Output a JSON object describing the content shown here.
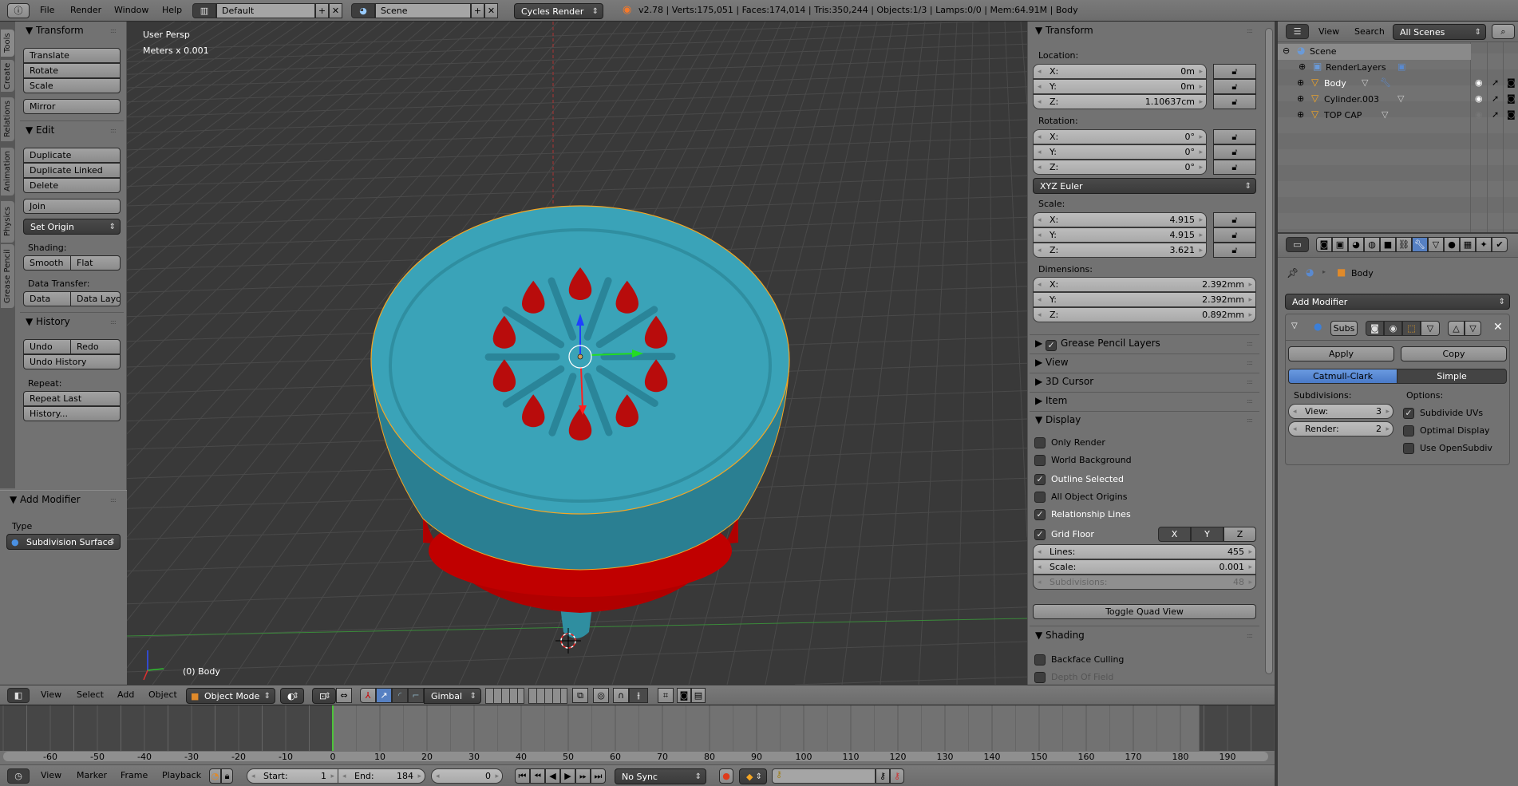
{
  "top_header": {
    "menus": [
      "File",
      "Render",
      "Window",
      "Help"
    ],
    "layout": "Default",
    "scene": "Scene",
    "engine": "Cycles Render",
    "stats": "v2.78 | Verts:175,051 | Faces:174,014 | Tris:350,244 | Objects:1/3 | Lamps:0/0 | Mem:64.91M | Body"
  },
  "tool_tabs": [
    "Tools",
    "Create",
    "Relations",
    "Animation",
    "Physics",
    "Grease Pencil"
  ],
  "toolshelf": {
    "transform": {
      "title": "Transform",
      "translate": "Translate",
      "rotate": "Rotate",
      "scale": "Scale",
      "mirror": "Mirror"
    },
    "edit": {
      "title": "Edit",
      "duplicate": "Duplicate",
      "duplicate_linked": "Duplicate Linked",
      "delete": "Delete",
      "join": "Join",
      "set_origin": "Set Origin",
      "shading_label": "Shading:",
      "smooth": "Smooth",
      "flat": "Flat",
      "data_transfer_label": "Data Transfer:",
      "data": "Data",
      "data_layout": "Data Layo"
    },
    "history": {
      "title": "History",
      "undo": "Undo",
      "redo": "Redo",
      "undo_history": "Undo History",
      "repeat_label": "Repeat:",
      "repeat_last": "Repeat Last",
      "history": "History..."
    },
    "operator": {
      "title": "Add Modifier",
      "type_label": "Type",
      "type_value": "Subdivision Surface"
    }
  },
  "viewport": {
    "view_name": "User Persp",
    "units": "Meters x 0.001",
    "object_label": "(0) Body",
    "colors": {
      "body": "#3aa3b8",
      "accent": "#c00000",
      "selection": "#f5a623"
    }
  },
  "n_panel": {
    "transform_title": "Transform",
    "location_label": "Location:",
    "location": [
      {
        "axis": "X:",
        "value": "0m"
      },
      {
        "axis": "Y:",
        "value": "0m"
      },
      {
        "axis": "Z:",
        "value": "1.10637cm"
      }
    ],
    "rotation_label": "Rotation:",
    "rotation": [
      {
        "axis": "X:",
        "value": "0°"
      },
      {
        "axis": "Y:",
        "value": "0°"
      },
      {
        "axis": "Z:",
        "value": "0°"
      }
    ],
    "rotation_mode": "XYZ Euler",
    "scale_label": "Scale:",
    "scale": [
      {
        "axis": "X:",
        "value": "4.915"
      },
      {
        "axis": "Y:",
        "value": "4.915"
      },
      {
        "axis": "Z:",
        "value": "3.621"
      }
    ],
    "dimensions_label": "Dimensions:",
    "dimensions": [
      {
        "axis": "X:",
        "value": "2.392mm"
      },
      {
        "axis": "Y:",
        "value": "2.392mm"
      },
      {
        "axis": "Z:",
        "value": "0.892mm"
      }
    ],
    "collapsed_panels": [
      "Grease Pencil Layers",
      "View",
      "3D Cursor",
      "Item"
    ],
    "display": {
      "title": "Display",
      "options": [
        {
          "label": "Only Render",
          "checked": false
        },
        {
          "label": "World Background",
          "checked": false
        },
        {
          "label": "Outline Selected",
          "checked": true
        },
        {
          "label": "All Object Origins",
          "checked": false
        },
        {
          "label": "Relationship Lines",
          "checked": true
        },
        {
          "label": "Grid Floor",
          "checked": true
        }
      ],
      "axes": [
        "X",
        "Y",
        "Z"
      ],
      "lines_label": "Lines:",
      "lines": "455",
      "scale_label": "Scale:",
      "scale": "0.001",
      "subdivisions_label": "Subdivisions:",
      "subdivisions": "48",
      "quad_view": "Toggle Quad View"
    },
    "shading": {
      "title": "Shading",
      "options": [
        {
          "label": "Backface Culling",
          "checked": false
        },
        {
          "label": "Depth Of Field",
          "checked": false
        }
      ]
    }
  },
  "outliner": {
    "menus": [
      "View",
      "Search"
    ],
    "filter": "All Scenes",
    "items": [
      {
        "name": "Scene"
      },
      {
        "name": "RenderLayers"
      },
      {
        "name": "Body"
      },
      {
        "name": "Cylinder.003"
      },
      {
        "name": "TOP CAP"
      }
    ]
  },
  "properties": {
    "breadcrumb": "Body",
    "add_modifier": "Add Modifier",
    "modifier": {
      "name": "Subs",
      "apply": "Apply",
      "copy": "Copy",
      "modes": [
        "Catmull-Clark",
        "Simple"
      ],
      "active_mode": "Catmull-Clark",
      "subdivisions_label": "Subdivisions:",
      "view_label": "View:",
      "view": "3",
      "render_label": "Render:",
      "render": "2",
      "options_label": "Options:",
      "options": [
        {
          "label": "Subdivide UVs",
          "checked": true
        },
        {
          "label": "Optimal Display",
          "checked": false
        },
        {
          "label": "Use OpenSubdiv",
          "checked": false
        }
      ]
    }
  },
  "view3d_header": {
    "menus": [
      "View",
      "Select",
      "Add",
      "Object"
    ],
    "mode": "Object Mode",
    "orientation": "Gimbal"
  },
  "timeline": {
    "ticks": [
      -60,
      -50,
      -40,
      -30,
      -20,
      -10,
      0,
      10,
      20,
      30,
      40,
      50,
      60,
      70,
      80,
      90,
      100,
      110,
      120,
      130,
      140,
      150,
      160,
      170,
      180,
      190
    ],
    "current_frame": 0,
    "menus": [
      "View",
      "Marker",
      "Frame",
      "Playback"
    ],
    "start_label": "Start:",
    "start": "1",
    "end_label": "End:",
    "end": "184",
    "frame": "0",
    "sync": "No Sync"
  }
}
